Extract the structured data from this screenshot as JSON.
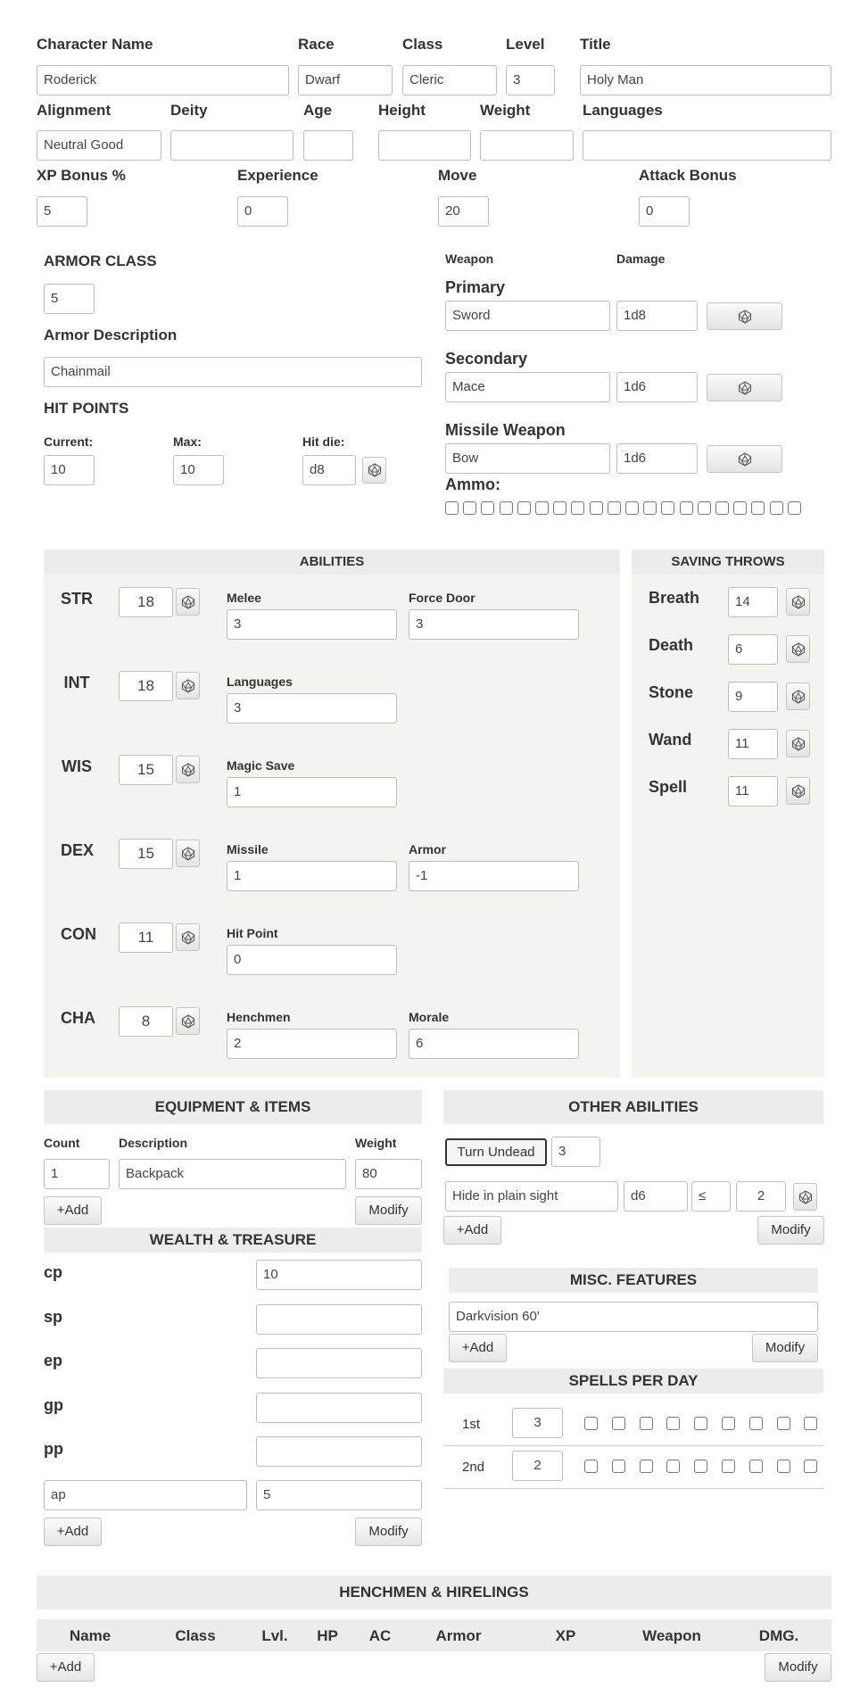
{
  "top": {
    "labels": {
      "character_name": "Character Name",
      "race": "Race",
      "class": "Class",
      "level": "Level",
      "title": "Title",
      "alignment": "Alignment",
      "deity": "Deity",
      "age": "Age",
      "height": "Height",
      "weight": "Weight",
      "languages": "Languages",
      "xp_bonus": "XP Bonus %",
      "experience": "Experience",
      "move": "Move",
      "attack_bonus": "Attack Bonus"
    },
    "values": {
      "character_name": "Roderick",
      "race": "Dwarf",
      "class": "Cleric",
      "level": "3",
      "title": "Holy Man",
      "alignment": "Neutral Good",
      "deity": "",
      "age": "",
      "height": "",
      "weight": "",
      "languages": "",
      "xp_bonus": "5",
      "experience": "0",
      "move": "20",
      "attack_bonus": "0"
    }
  },
  "armor": {
    "ac_label": "ARMOR CLASS",
    "ac_value": "5",
    "desc_label": "Armor Description",
    "desc_value": "Chainmail"
  },
  "hp": {
    "title": "HIT POINTS",
    "current_label": "Current:",
    "current": "10",
    "max_label": "Max:",
    "max": "10",
    "die_label": "Hit die:",
    "die": "d8"
  },
  "weapons": {
    "col_weapon": "Weapon",
    "col_damage": "Damage",
    "primary_label": "Primary",
    "primary": "Sword",
    "primary_dmg": "1d8",
    "secondary_label": "Secondary",
    "secondary": "Mace",
    "secondary_dmg": "1d6",
    "missile_label": "Missile Weapon",
    "missile": "Bow",
    "missile_dmg": "1d6",
    "ammo_label": "Ammo:",
    "ammo_boxes": 20
  },
  "abilities": {
    "title": "ABILITIES",
    "rows": [
      {
        "name": "STR",
        "score": "18",
        "mods": [
          {
            "label": "Melee",
            "value": "3"
          },
          {
            "label": "Force Door",
            "value": "3"
          }
        ]
      },
      {
        "name": "INT",
        "score": "18",
        "mods": [
          {
            "label": "Languages",
            "value": "3"
          }
        ]
      },
      {
        "name": "WIS",
        "score": "15",
        "mods": [
          {
            "label": "Magic Save",
            "value": "1"
          }
        ]
      },
      {
        "name": "DEX",
        "score": "15",
        "mods": [
          {
            "label": "Missile",
            "value": "1"
          },
          {
            "label": "Armor",
            "value": "-1"
          }
        ]
      },
      {
        "name": "CON",
        "score": "11",
        "mods": [
          {
            "label": "Hit Point",
            "value": "0"
          }
        ]
      },
      {
        "name": "CHA",
        "score": "8",
        "mods": [
          {
            "label": "Henchmen",
            "value": "2"
          },
          {
            "label": "Morale",
            "value": "6"
          }
        ]
      }
    ]
  },
  "saves": {
    "title": "SAVING THROWS",
    "rows": [
      {
        "name": "Breath",
        "value": "14"
      },
      {
        "name": "Death",
        "value": "6"
      },
      {
        "name": "Stone",
        "value": "9"
      },
      {
        "name": "Wand",
        "value": "11"
      },
      {
        "name": "Spell",
        "value": "11"
      }
    ]
  },
  "equipment": {
    "title": "EQUIPMENT & ITEMS",
    "col_count": "Count",
    "col_desc": "Description",
    "col_weight": "Weight",
    "items": [
      {
        "count": "1",
        "desc": "Backpack",
        "weight": "80"
      }
    ],
    "add": "+Add",
    "modify": "Modify"
  },
  "wealth": {
    "title": "WEALTH & TREASURE",
    "rows": [
      {
        "name": "cp",
        "value": "10"
      },
      {
        "name": "sp",
        "value": ""
      },
      {
        "name": "ep",
        "value": ""
      },
      {
        "name": "gp",
        "value": ""
      },
      {
        "name": "pp",
        "value": ""
      }
    ],
    "custom_name": "ap",
    "custom_value": "5",
    "add": "+Add",
    "modify": "Modify"
  },
  "other": {
    "title": "OTHER ABILITIES",
    "turn_undead_label": "Turn Undead",
    "turn_undead_value": "3",
    "skill_name": "Hide in plain sight",
    "skill_die": "d6",
    "skill_op": "≤",
    "skill_target": "2",
    "add": "+Add",
    "modify": "Modify"
  },
  "misc": {
    "title": "MISC. FEATURES",
    "item": "Darkvision 60'",
    "add": "+Add",
    "modify": "Modify"
  },
  "spells": {
    "title": "SPELLS PER DAY",
    "rows": [
      {
        "level": "1st",
        "count": "3",
        "boxes": 9
      },
      {
        "level": "2nd",
        "count": "2",
        "boxes": 9
      }
    ]
  },
  "henchmen": {
    "title": "HENCHMEN & HIRELINGS",
    "columns": [
      "Name",
      "Class",
      "Lvl.",
      "HP",
      "AC",
      "Armor",
      "XP",
      "Weapon",
      "DMG."
    ],
    "add": "+Add",
    "modify": "Modify"
  }
}
